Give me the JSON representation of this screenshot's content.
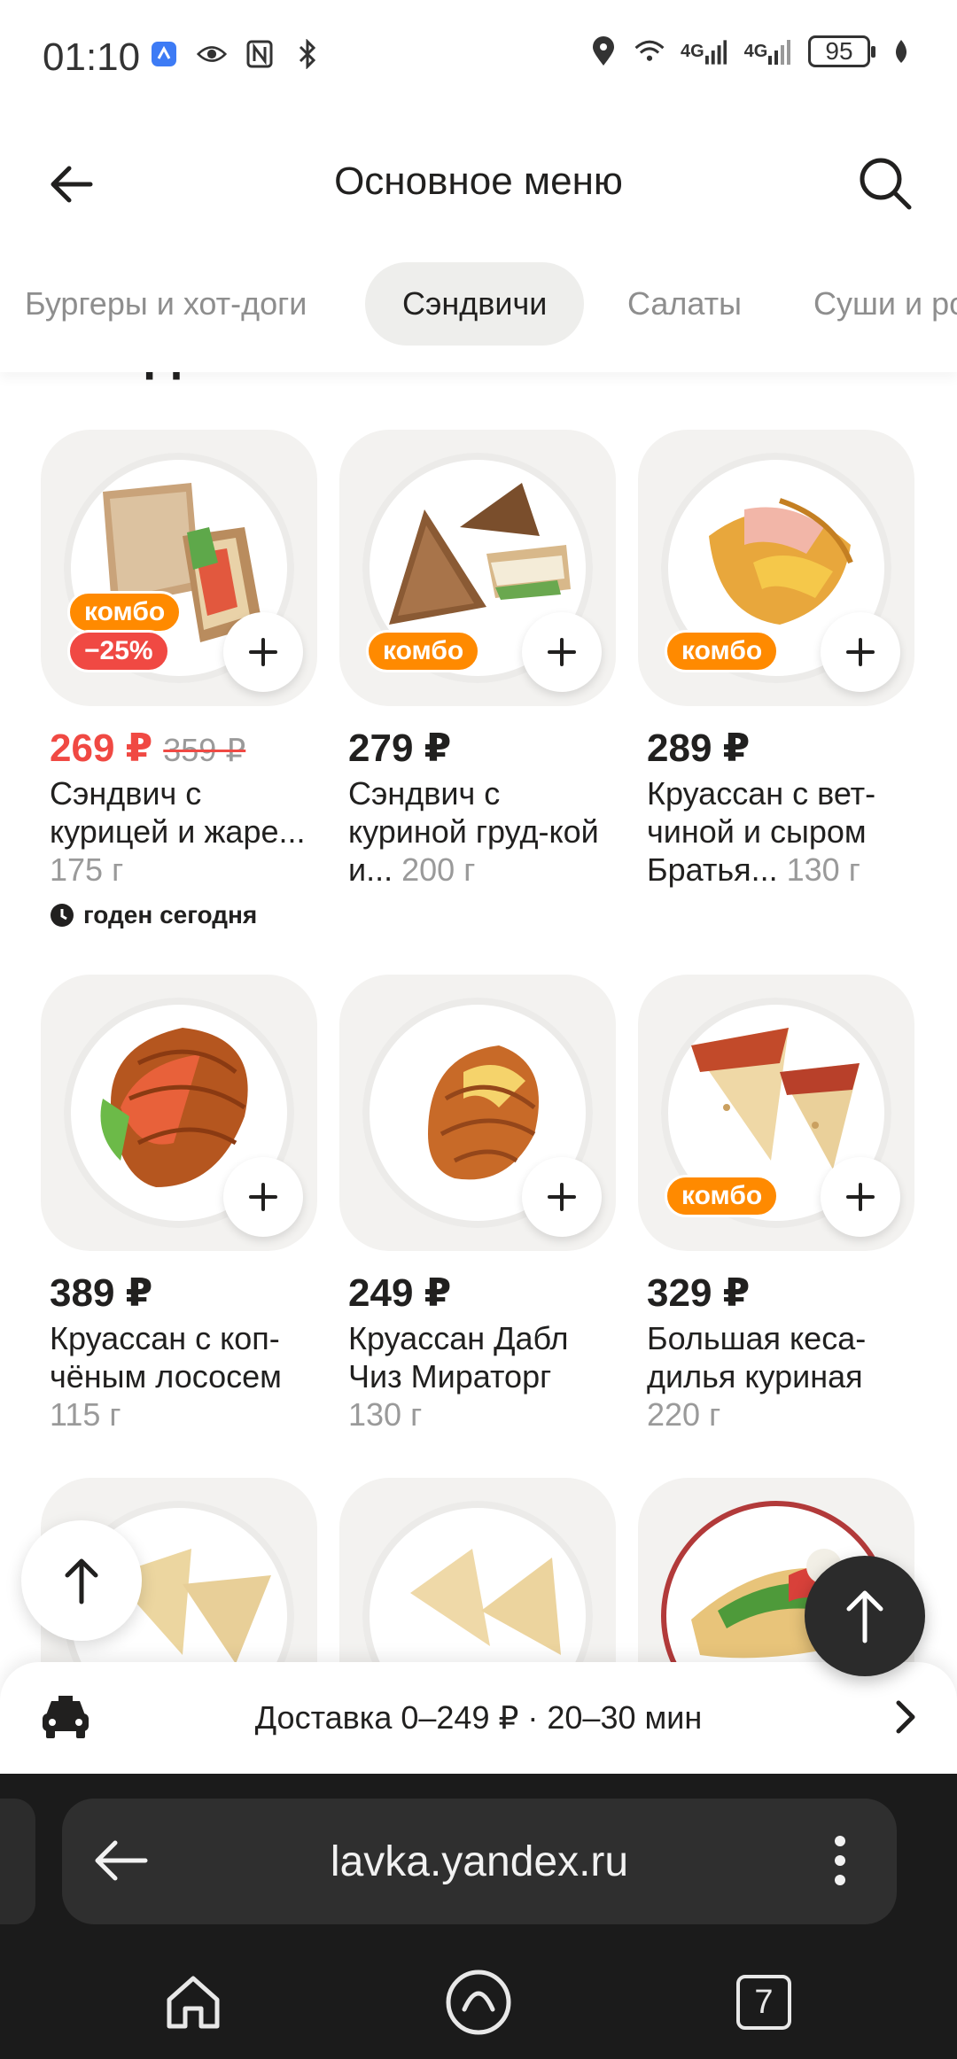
{
  "status_bar": {
    "time": "01:10",
    "battery": "95",
    "network_1": "4G",
    "network_2": "4G"
  },
  "header": {
    "title": "Основное меню"
  },
  "tabs": [
    {
      "label": "Бургеры и хот-доги"
    },
    {
      "label": "Сэндвичи"
    },
    {
      "label": "Салаты"
    },
    {
      "label": "Суши и ро"
    }
  ],
  "section": {
    "title": "Сэндвичи"
  },
  "products": [
    {
      "price": "269 ₽",
      "old_price": "359 ₽",
      "name": "Сэндвич с курицей и жаре...",
      "weight": "175 г",
      "badges": [
        "комбо",
        "−25%"
      ],
      "note": "годен сегодня"
    },
    {
      "price": "279 ₽",
      "name": "Сэндвич с куриной груд-кой и...",
      "weight": "200 г",
      "badges": [
        "комбо"
      ]
    },
    {
      "price": "289 ₽",
      "name": "Круассан с вет-чиной и сыром Братья...",
      "weight": "130 г",
      "badges": [
        "комбо"
      ]
    },
    {
      "price": "389 ₽",
      "name": "Круассан с коп-чёным лососем",
      "weight": "115 г"
    },
    {
      "price": "249 ₽",
      "name": "Круассан Дабл Чиз Мираторг",
      "weight": "130 г"
    },
    {
      "price": "329 ₽",
      "name": "Большая кеса-дилья куриная",
      "weight": "220 г",
      "badges": [
        "комбо"
      ]
    }
  ],
  "delivery": {
    "text": "Доставка 0–249 ₽ · 20–30 мин"
  },
  "browser": {
    "url": "lavka.yandex.ru",
    "tabs_count": "7"
  },
  "colors": {
    "accent_combo": "#ff8a00",
    "sale_red": "#f04943",
    "card_bg": "#f3f2f0"
  }
}
